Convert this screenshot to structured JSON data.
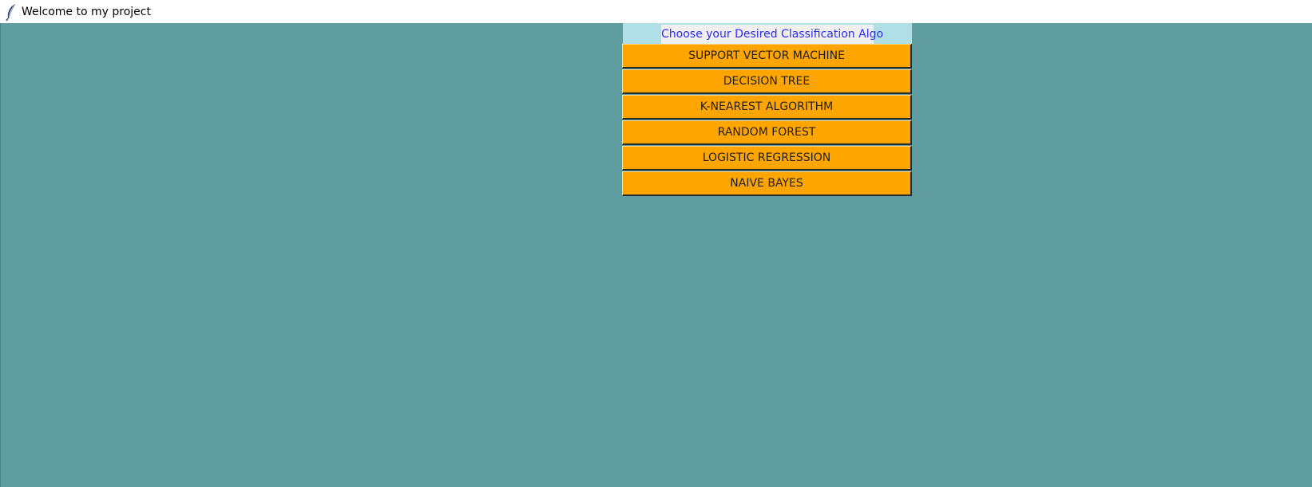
{
  "window": {
    "title": "Welcome to my project",
    "icon": "feather-icon"
  },
  "colors": {
    "background": "#5f9ea0",
    "header_frame": "#b0e0e6",
    "header_text": "#2b2bff",
    "button_bg": "#ffa500"
  },
  "header": {
    "label": "Choose your Desired Classification Algo"
  },
  "buttons": [
    {
      "label": "SUPPORT VECTOR MACHINE"
    },
    {
      "label": "DECISION TREE"
    },
    {
      "label": "K-NEAREST ALGORITHM"
    },
    {
      "label": "RANDOM FOREST"
    },
    {
      "label": "LOGISTIC REGRESSION"
    },
    {
      "label": "NAIVE BAYES"
    }
  ]
}
